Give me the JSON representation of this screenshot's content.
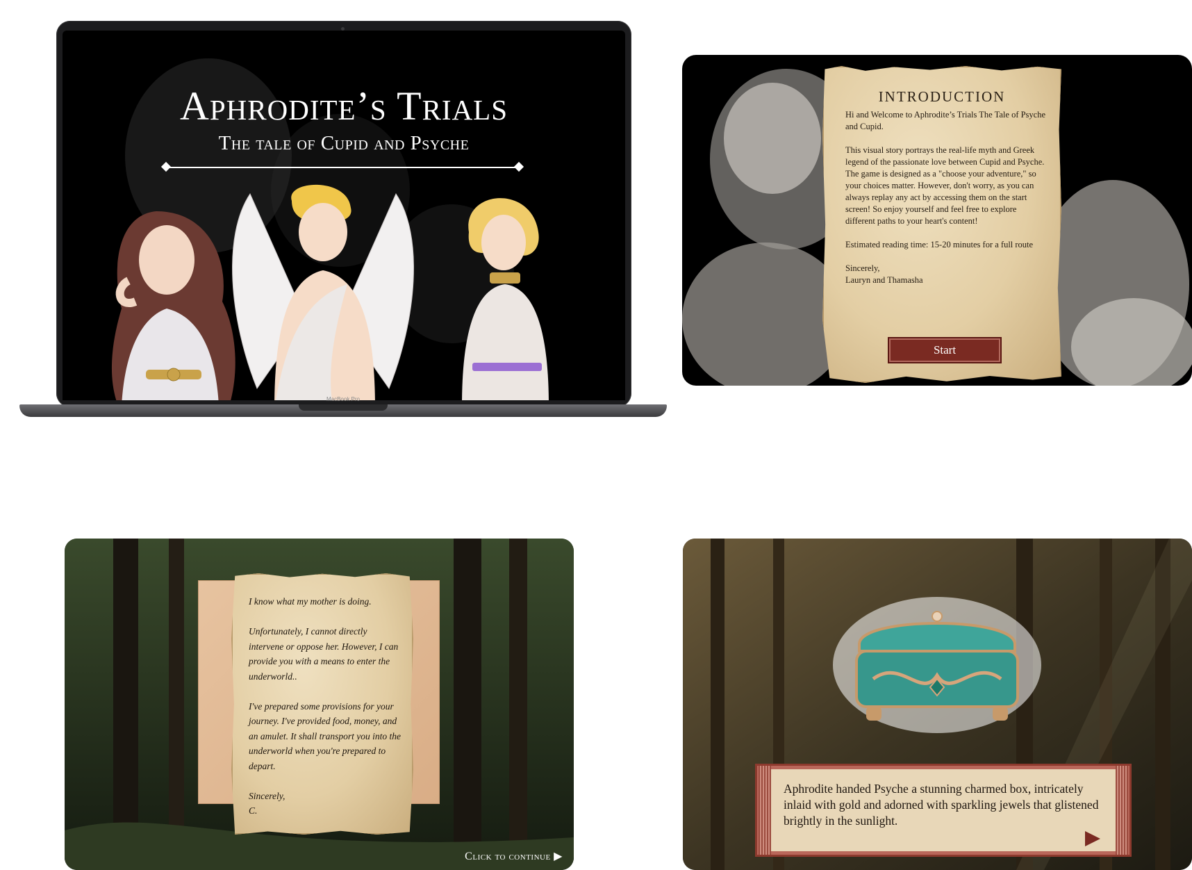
{
  "title_screen": {
    "title": "Aphrodite’s Trials",
    "subtitle": "The tale of Cupid and Psyche",
    "device_label": "MacBook Pro"
  },
  "intro_screen": {
    "heading": "INTRODUCTION",
    "paragraphs": [
      "Hi and Welcome to Aphrodite’s Trials The Tale of Psyche and Cupid.",
      "This visual story portrays the real-life myth and Greek legend of the passionate love between Cupid and Psyche. The game is designed as a \"choose your adventure,\" so your choices matter. However, don't worry, as you can always replay any act by accessing them on the start screen! So enjoy yourself and feel free to explore different paths to your heart's content!",
      "Estimated reading time: 15-20 minutes for a full route"
    ],
    "signoff": "Sincerely,",
    "authors": "Lauryn and Thamasha",
    "start_label": "Start"
  },
  "letter_screen": {
    "lines": [
      "I know what my mother is doing.",
      "Unfortunately, I cannot directly intervene or oppose her. However, I can provide you with a means to enter the underworld..",
      "I've prepared some provisions for your journey. I've provided food, money, and an amulet. It shall transport you into the underworld when you're prepared to depart."
    ],
    "signoff": "Sincerely,",
    "signature": "C.",
    "continue_label": "Click to continue ▶"
  },
  "box_screen": {
    "caption": "Aphrodite handed Psyche a stunning charmed box, intricately inlaid with gold and adorned with sparkling jewels that glistened brightly in the sunlight."
  },
  "colors": {
    "button_red": "#7a2a22",
    "parchment": "#e3cea4",
    "box_teal": "#3fa59a",
    "gold": "#c9a24a"
  }
}
